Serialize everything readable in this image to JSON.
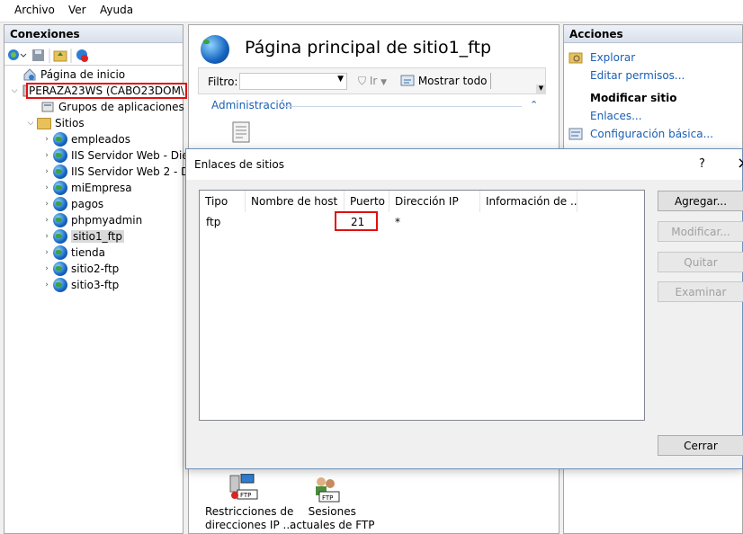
{
  "menu": [
    "Archivo",
    "Ver",
    "Ayuda"
  ],
  "connections": {
    "title": "Conexiones",
    "tree": {
      "home": "Página de inicio",
      "server": "PERAZA23WS (CABO23DOM\\",
      "app_pools": "Grupos de aplicaciones",
      "sites_label": "Sitios",
      "sites": [
        "empleados",
        "IIS Servidor Web - Dieg",
        "IIS Servidor Web 2 - Di",
        "miEmpresa",
        "pagos",
        "phpmyadmin",
        "sitio1_ftp",
        "tienda",
        "sitio2-ftp",
        "sitio3-ftp"
      ]
    }
  },
  "main": {
    "title": "Página principal de sitio1_ftp",
    "filter_label": "Filtro:",
    "go_label": "Ir",
    "show_all": "Mostrar todo",
    "group_header": "Administración",
    "features": [
      {
        "line1": "Restricciones de",
        "line2": "direcciones IP ..."
      },
      {
        "line1": "Sesiones",
        "line2": "actuales de FTP"
      }
    ]
  },
  "actions": {
    "title": "Acciones",
    "explore": "Explorar",
    "edit_permissions": "Editar permisos...",
    "modify_site": "Modificar sitio",
    "bindings": "Enlaces...",
    "basic_config": "Configuración básica..."
  },
  "dialog": {
    "title": "Enlaces de sitios",
    "help": "?",
    "close_x": "×",
    "columns": [
      "Tipo",
      "Nombre de host",
      "Puerto",
      "Dirección IP",
      "Información de ..."
    ],
    "rows": [
      [
        "ftp",
        "",
        "21",
        "*",
        ""
      ]
    ],
    "buttons": {
      "add": "Agregar...",
      "modify": "Modificar...",
      "remove": "Quitar",
      "browse": "Examinar",
      "close": "Cerrar"
    }
  },
  "colors": {
    "highlight": "#e01010",
    "link": "#1a5fb4",
    "selection": "#cde8ff"
  }
}
